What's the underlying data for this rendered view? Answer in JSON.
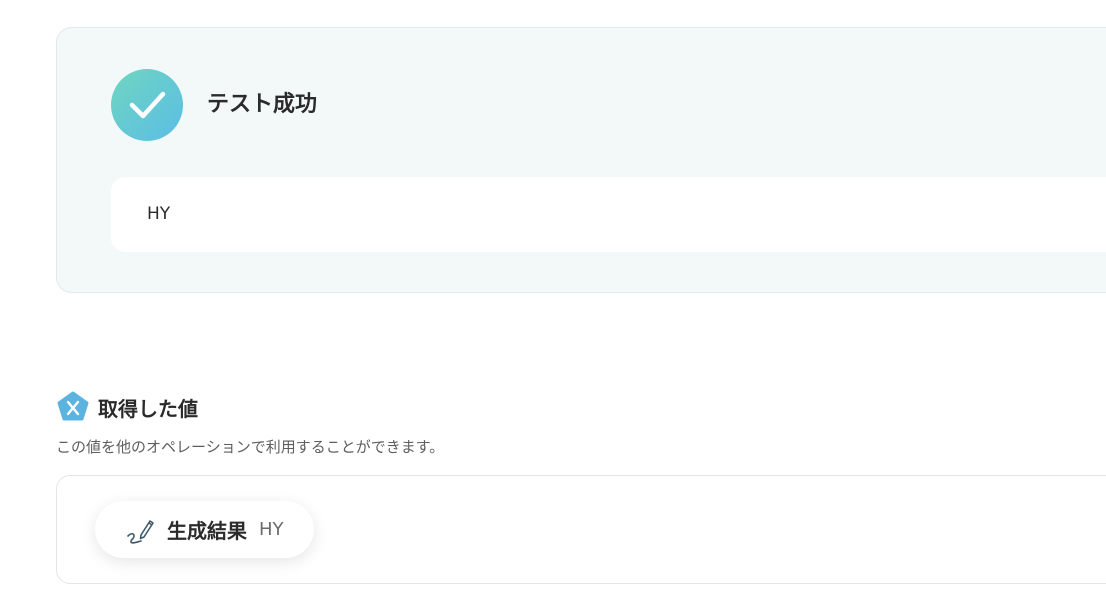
{
  "test_result": {
    "title": "テスト成功",
    "output": "HY",
    "icon": "check-icon"
  },
  "acquired_values": {
    "title": "取得した値",
    "description": "この値を他のオペレーションで利用することができます。",
    "icon": "variable-x-icon",
    "items": [
      {
        "label": "生成結果",
        "value": "HY",
        "icon": "pen-signature-icon"
      }
    ]
  },
  "colors": {
    "success_gradient_start": "#6fd6c0",
    "success_gradient_end": "#5bbde6",
    "panel_background": "#f3f9f9",
    "variable_icon": "#5bb4e0"
  }
}
